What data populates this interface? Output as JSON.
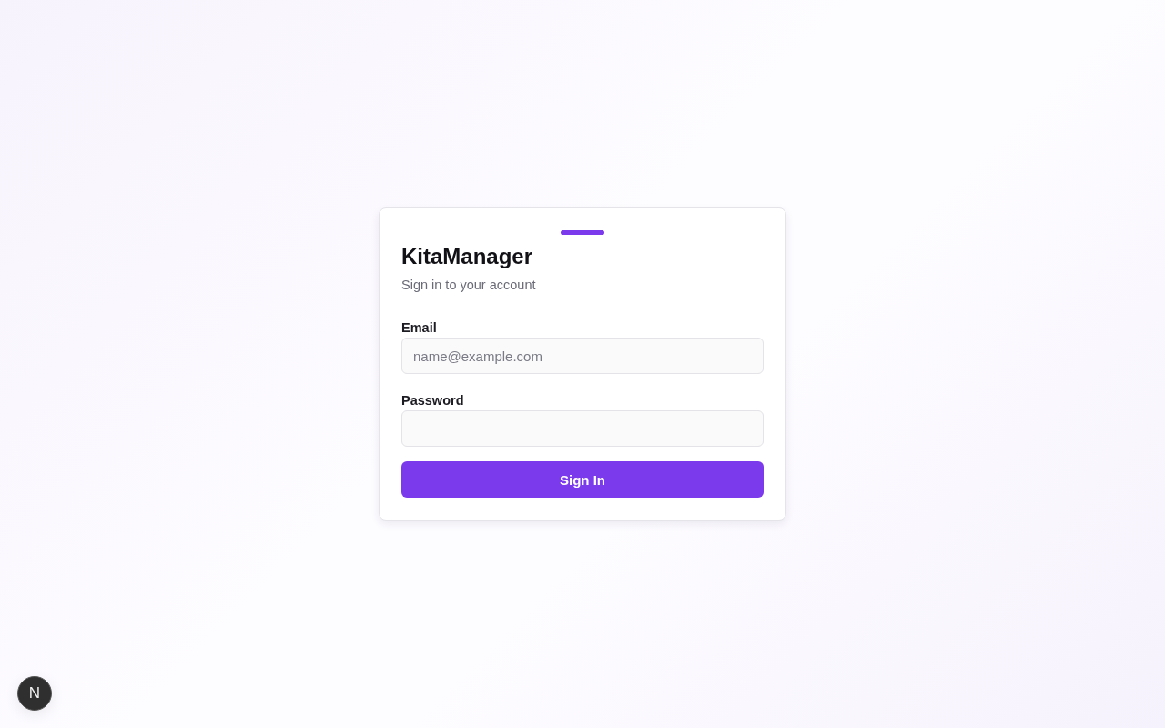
{
  "card": {
    "title": "KitaManager",
    "subtitle": "Sign in to your account"
  },
  "fields": [
    {
      "label": "Email",
      "placeholder": "name@example.com"
    },
    {
      "label": "Password"
    }
  ],
  "submit": {
    "label": "Sign In"
  },
  "dev_indicator": {
    "label": "N"
  }
}
